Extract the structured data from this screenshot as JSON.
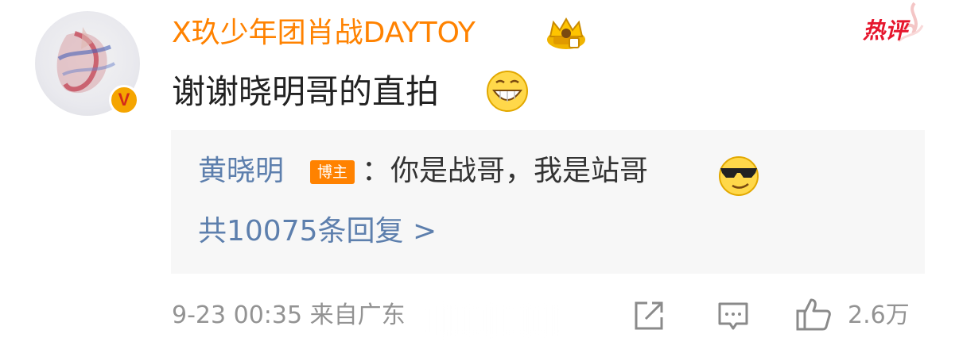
{
  "comment": {
    "username": "X玖少年团肖战DAYTOY",
    "text": "谢谢晓明哥的直拍",
    "hot_label": "热评"
  },
  "reply": {
    "author": "黄晓明",
    "badge": "博主",
    "text": "：你是战哥，我是站哥",
    "count_text": "共10075条回复 >"
  },
  "footer": {
    "meta": "9-23 00:35 来自广东",
    "like_count": "2.6万"
  },
  "icons": {
    "verified": "verified-v-icon",
    "crown": "crown-badge-icon",
    "grin": "grin-emoji-icon",
    "cool": "sunglasses-emoji-icon",
    "share": "share-icon",
    "comment": "comment-icon",
    "like": "thumbs-up-icon"
  },
  "colors": {
    "username": "#ff8200",
    "link": "#5d7fad",
    "hot": "#e6162d",
    "meta": "#939393",
    "reply_bg": "#f7f7f7"
  }
}
